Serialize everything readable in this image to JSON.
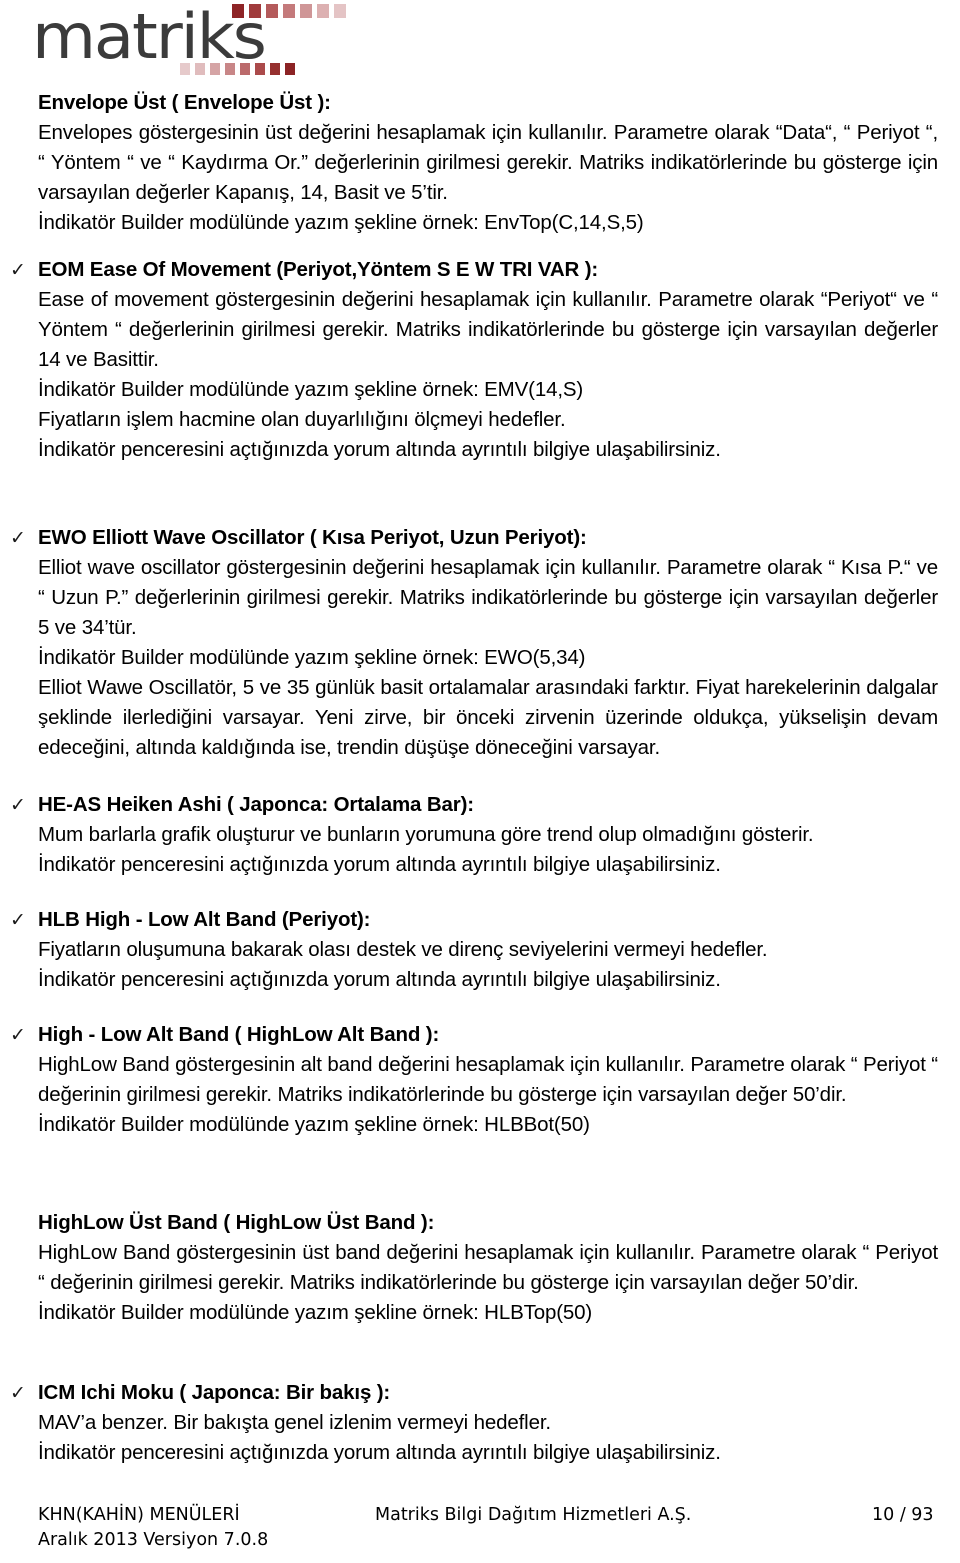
{
  "logo": {
    "word": "matriks",
    "word_color": "#3b3b3b",
    "dots_top": [
      "#8e2426",
      "#a03b3c",
      "#b45a5b",
      "#c47a7b",
      "#cf9697",
      "#dcb0b1",
      "#e4c4c5"
    ],
    "dots_bottom": [
      "#e6cacb",
      "#e0bcbd",
      "#d5a4a5",
      "#c88687",
      "#bb6a6b",
      "#ab4a4b",
      "#96302f",
      "#8c2325"
    ]
  },
  "sections": [
    {
      "check": "",
      "heading": "Envelope Üst ( Envelope Üst ):",
      "paragraph": "Envelopes göstergesinin üst değerini hesaplamak için kullanılır. Parametre olarak “Data“,   “ Periyot “, “ Yöntem “ ve “ Kaydırma Or.” değerlerinin girilmesi gerekir. Matriks indikatörlerinde bu gösterge için varsayılan değerler Kapanış, 14, Basit ve 5’tir.",
      "lines": [
        "İndikatör Builder modülünde yazım şekline örnek: EnvTop(C,14,S,5)"
      ]
    },
    {
      "check": "✓",
      "heading": "EOM  Ease Of Movement (Periyot,Yöntem S E W TRI VAR ):",
      "paragraph": "Ease of movement göstergesinin değerini hesaplamak için kullanılır. Parametre olarak “Periyot“ ve “ Yöntem “ değerlerinin girilmesi gerekir. Matriks indikatörlerinde bu gösterge için varsayılan değerler 14 ve Basittir.",
      "lines": [
        "İndikatör Builder modülünde yazım şekline örnek: EMV(14,S)",
        "Fiyatların işlem hacmine olan duyarlılığını ölçmeyi hedefler.",
        "İndikatör penceresini açtığınızda yorum altında ayrıntılı bilgiye ulaşabilirsiniz."
      ]
    },
    {
      "check": "✓",
      "heading": "EWO  Elliott Wave Oscillator ( Kısa Periyot, Uzun Periyot):",
      "paragraph": "Elliot wave oscillator göstergesinin değerini hesaplamak için kullanılır. Parametre olarak “ Kısa P.“ ve “ Uzun P.” değerlerinin girilmesi gerekir. Matriks indikatörlerinde bu gösterge için varsayılan değerler 5 ve 34’tür.",
      "lines": [
        "İndikatör Builder modülünde yazım şekline örnek: EWO(5,34)"
      ],
      "paragraph2": "Elliot Wawe Oscillatör, 5 ve 35 günlük basit ortalamalar arasındaki farktır. Fiyat harekelerinin dalgalar şeklinde ilerlediğini varsayar. Yeni zirve, bir önceki zirvenin üzerinde oldukça, yükselişin devam edeceğini, altında kaldığında ise, trendin düşüşe döneceğini varsayar."
    },
    {
      "check": "✓",
      "heading": "HE-AS  Heiken Ashi ( Japonca: Ortalama Bar):",
      "lines": [
        "Mum barlarla grafik oluşturur ve bunların yorumuna göre trend olup olmadığını gösterir.",
        "İndikatör penceresini açtığınızda yorum altında ayrıntılı bilgiye ulaşabilirsiniz."
      ]
    },
    {
      "check": "✓",
      "heading": "HLB  High - Low Alt Band (Periyot):",
      "lines": [
        "Fiyatların oluşumuna bakarak olası destek ve direnç seviyelerini vermeyi hedefler.",
        "İndikatör penceresini açtığınızda yorum altında ayrıntılı bilgiye ulaşabilirsiniz."
      ]
    },
    {
      "check": "✓",
      "heading": "High - Low Alt Band ( HighLow Alt Band ):",
      "paragraph": "HighLow Band göstergesinin alt band değerini hesaplamak için kullanılır. Parametre olarak “ Periyot “ değerinin girilmesi gerekir. Matriks indikatörlerinde bu gösterge için varsayılan değer 50’dir.",
      "lines": [
        "İndikatör Builder modülünde yazım şekline örnek: HLBBot(50)"
      ]
    },
    {
      "check": "",
      "heading": "HighLow Üst Band ( HighLow Üst Band ):",
      "paragraph": "HighLow Band göstergesinin üst band değerini hesaplamak için kullanılır. Parametre olarak “ Periyot “ değerinin girilmesi gerekir. Matriks indikatörlerinde bu gösterge için varsayılan değer 50’dir.",
      "lines": [
        "İndikatör Builder modülünde yazım şekline örnek: HLBTop(50)"
      ]
    },
    {
      "check": "✓",
      "heading": "ICM  Ichi Moku ( Japonca: Bir bakış ):",
      "lines": [
        "MAV’a benzer. Bir bakışta genel izlenim vermeyi hedefler.",
        "İndikatör penceresini açtığınızda yorum altında ayrıntılı bilgiye ulaşabilirsiniz."
      ]
    }
  ],
  "footer": {
    "left": "KHN(KAHİN) MENÜLERİ\nAralık 2013 Versiyon 7.0.8",
    "center": "Matriks Bilgi Dağıtım Hizmetleri A.Ş.",
    "right": "10 / 93"
  }
}
